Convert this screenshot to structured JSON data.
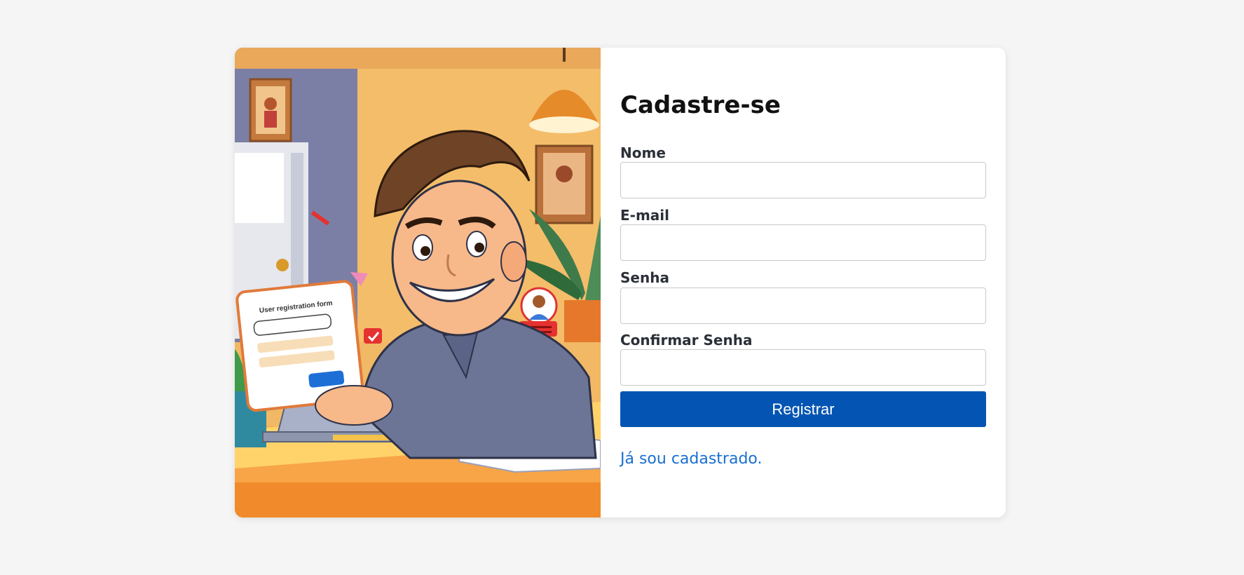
{
  "form": {
    "title": "Cadastre-se",
    "fields": [
      {
        "label": "Nome",
        "value": ""
      },
      {
        "label": "E-mail",
        "value": ""
      },
      {
        "label": "Senha",
        "value": ""
      },
      {
        "label": "Confirmar Senha",
        "value": ""
      }
    ],
    "submit_label": "Registrar",
    "login_link": "Já sou cadastrado."
  },
  "illustration": {
    "form_card_title": "User registration form"
  },
  "colors": {
    "primary": "#0455b3",
    "link": "#1a6fd1",
    "background": "#f5f5f5"
  }
}
